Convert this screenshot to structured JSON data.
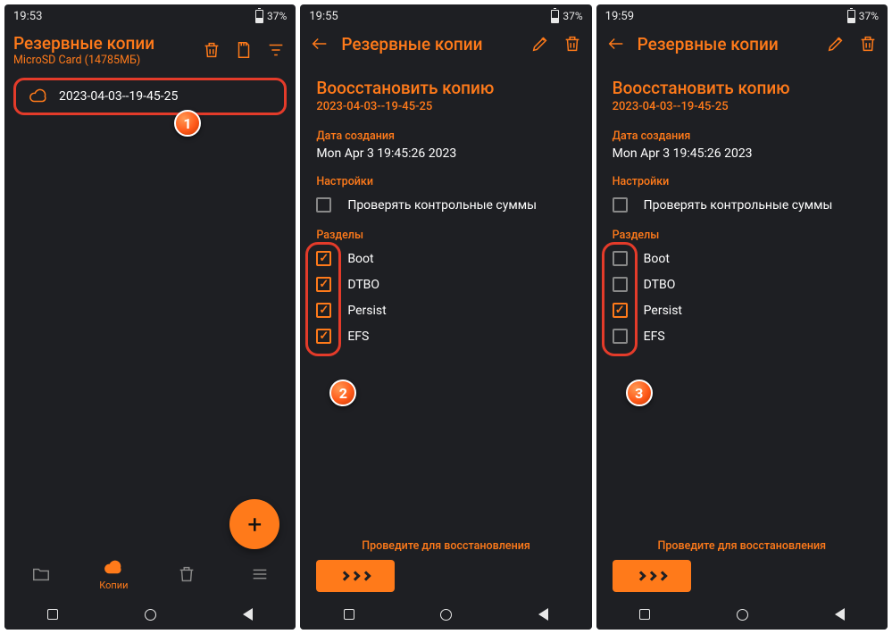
{
  "colors": {
    "accent": "#ff7a1a",
    "bg": "#1e1f23",
    "highlight": "#e43b2a"
  },
  "phone1": {
    "status": {
      "time": "19:53",
      "battery": "37%"
    },
    "title": "Резервные копии",
    "subtitle": "MicroSD Card (14785МБ)",
    "backup_item": "2023-04-03--19-45-25",
    "fab": "+",
    "bottomnav": {
      "folder": "",
      "copies": "Копии",
      "trash": "",
      "menu": ""
    }
  },
  "phone2": {
    "status": {
      "time": "19:55",
      "battery": "37%"
    },
    "header": "Резервные копии",
    "restore_title": "Воосстановить копию",
    "restore_sub": "2023-04-03--19-45-25",
    "date_label": "Дата создания",
    "date_value": "Mon Apr  3 19:45:26 2023",
    "settings_label": "Настройки",
    "checksum_label": "Проверять контрольные суммы",
    "checksum_checked": false,
    "partitions_label": "Разделы",
    "partitions": [
      {
        "name": "Boot",
        "checked": true
      },
      {
        "name": "DTBO",
        "checked": true
      },
      {
        "name": "Persist",
        "checked": true
      },
      {
        "name": "EFS",
        "checked": true
      }
    ],
    "swipe_hint": "Проведите для восстановления"
  },
  "phone3": {
    "status": {
      "time": "19:59",
      "battery": "37%"
    },
    "header": "Резервные копии",
    "restore_title": "Воосстановить копию",
    "restore_sub": "2023-04-03--19-45-25",
    "date_label": "Дата создания",
    "date_value": "Mon Apr  3 19:45:26 2023",
    "settings_label": "Настройки",
    "checksum_label": "Проверять контрольные суммы",
    "checksum_checked": false,
    "partitions_label": "Разделы",
    "partitions": [
      {
        "name": "Boot",
        "checked": false
      },
      {
        "name": "DTBO",
        "checked": false
      },
      {
        "name": "Persist",
        "checked": true
      },
      {
        "name": "EFS",
        "checked": false
      }
    ],
    "swipe_hint": "Проведите для восстановления"
  },
  "annotations": {
    "b1": "1",
    "b2": "2",
    "b3": "3"
  }
}
